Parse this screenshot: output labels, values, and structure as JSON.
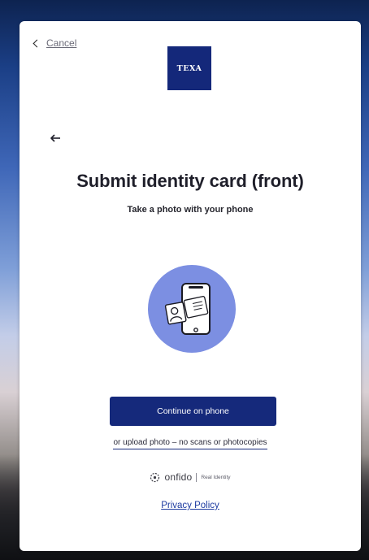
{
  "header": {
    "cancel_label": "Cancel",
    "logo_text": "TEXA"
  },
  "main": {
    "title": "Submit identity card (front)",
    "subtitle": "Take a photo with your phone",
    "continue_label": "Continue on phone",
    "upload_label": "or upload photo – no scans or photocopies"
  },
  "footer": {
    "brand": "onfido",
    "tagline": "Real Identity",
    "privacy_label": "Privacy Policy"
  },
  "colors": {
    "primary": "#15297b",
    "illustration_circle": "#7c8fe2",
    "link": "#1c3aa0"
  },
  "icons": [
    "chevron-left-icon",
    "back-arrow-icon",
    "phone-id-card-illustration",
    "onfido-logo-icon"
  ]
}
